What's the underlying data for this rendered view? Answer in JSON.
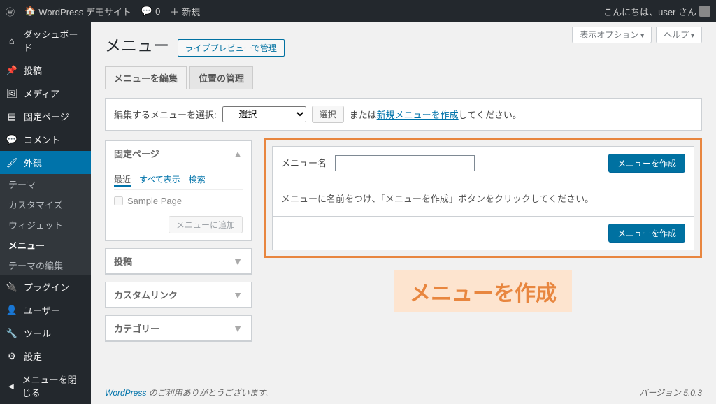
{
  "adminbar": {
    "site_name": "WordPress デモサイト",
    "comments": "0",
    "new": "新規",
    "greeting": "こんにちは、user さん"
  },
  "sidebar": {
    "dashboard": "ダッシュボード",
    "posts": "投稿",
    "media": "メディア",
    "pages": "固定ページ",
    "comments": "コメント",
    "appearance": "外観",
    "appearance_sub": {
      "themes": "テーマ",
      "customize": "カスタマイズ",
      "widgets": "ウィジェット",
      "menus": "メニュー",
      "editor": "テーマの編集"
    },
    "plugins": "プラグイン",
    "users": "ユーザー",
    "tools": "ツール",
    "settings": "設定",
    "collapse": "メニューを閉じる"
  },
  "screen": {
    "options": "表示オプション",
    "help": "ヘルプ"
  },
  "page": {
    "title": "メニュー",
    "title_action": "ライブプレビューで管理",
    "tab_edit": "メニューを編集",
    "tab_locations": "位置の管理"
  },
  "manage": {
    "label": "編集するメニューを選択:",
    "select_placeholder": "— 選択 —",
    "select_btn": "選択",
    "or_prefix": "または",
    "create_link": "新規メニューを作成",
    "or_suffix": "してください。"
  },
  "metaboxes": {
    "pages": "固定ページ",
    "pages_tabs": {
      "recent": "最近",
      "all": "すべて表示",
      "search": "検索"
    },
    "sample_page": "Sample Page",
    "add_to_menu": "メニューに追加",
    "posts": "投稿",
    "custom_links": "カスタムリンク",
    "categories": "カテゴリー"
  },
  "editor": {
    "menu_name_label": "メニュー名",
    "create_button": "メニューを作成",
    "body_text": "メニューに名前をつけ、「メニューを作成」ボタンをクリックしてください。"
  },
  "callout": "メニューを作成",
  "footer": {
    "wp": "WordPress",
    "thanks": " のご利用ありがとうございます。",
    "version": "バージョン 5.0.3"
  }
}
